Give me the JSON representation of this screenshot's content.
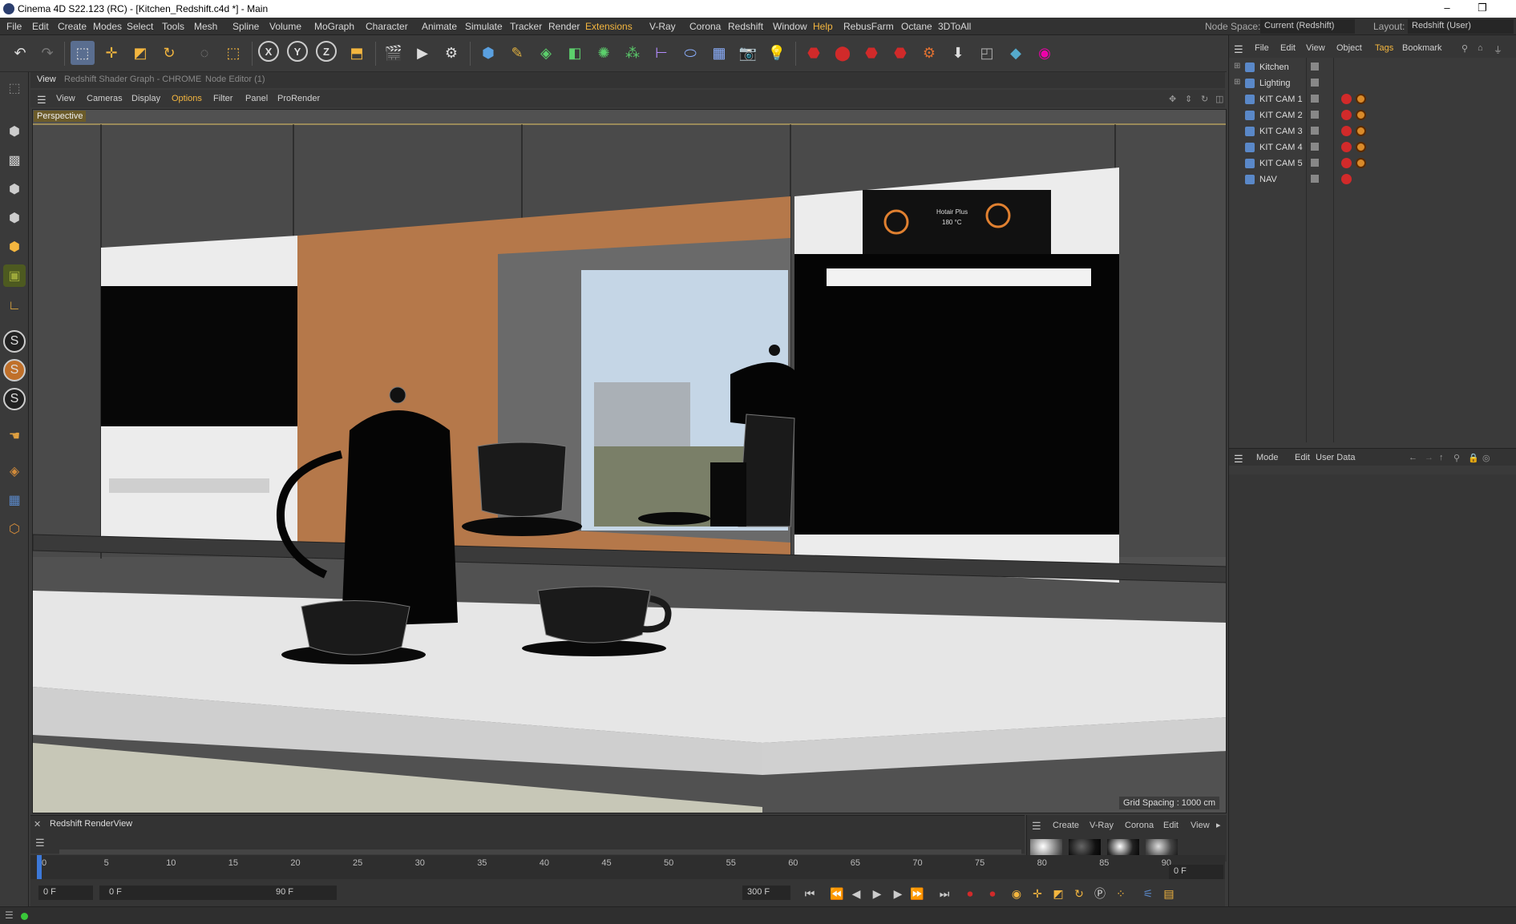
{
  "window": {
    "title": "Cinema 4D S22.123 (RC) - [Kitchen_Redshift.c4d *] - Main",
    "minimize": "–",
    "restore": "❐"
  },
  "menubar": {
    "items": [
      "File",
      "Edit",
      "Create",
      "Modes",
      "Select",
      "Tools",
      "Mesh",
      "Spline",
      "Volume",
      "MoGraph",
      "Character",
      "Animate",
      "Simulate",
      "Tracker",
      "Render",
      "Extensions",
      "V-Ray",
      "Corona",
      "Redshift",
      "Window",
      "Help",
      "RebusFarm",
      "Octane",
      "3DToAll"
    ],
    "node_space_label": "Node Space:",
    "node_space_value": "Current (Redshift)",
    "layout_label": "Layout:",
    "layout_value": "Redshift (User)"
  },
  "tabs": [
    "View",
    "Redshift Shader Graph - CHROME",
    "Node Editor (1)"
  ],
  "viewport_menu": [
    "View",
    "Cameras",
    "Display",
    "Options",
    "Filter",
    "Panel",
    "ProRender"
  ],
  "viewport": {
    "label": "Perspective",
    "grid_spacing": "Grid Spacing : 1000 cm",
    "oven_display": "Hotair Plus",
    "oven_temp": "180 °C"
  },
  "object_manager": {
    "menu": [
      "File",
      "Edit",
      "View",
      "Object",
      "Tags",
      "Bookmark"
    ],
    "objects": [
      {
        "name": "Kitchen",
        "tags": 0
      },
      {
        "name": "Lighting",
        "tags": 0
      },
      {
        "name": "KIT CAM 1",
        "tags": 2
      },
      {
        "name": "KIT CAM 2",
        "tags": 2
      },
      {
        "name": "KIT  CAM 3",
        "tags": 2
      },
      {
        "name": "KIT  CAM 4",
        "tags": 2
      },
      {
        "name": "KIT  CAM 5",
        "tags": 2
      },
      {
        "name": "NAV",
        "tags": 1
      }
    ]
  },
  "attributes": {
    "menu": [
      "Mode",
      "Edit",
      "User Data"
    ]
  },
  "renderview": {
    "title": "Redshift RenderView"
  },
  "material_panel": {
    "menu": [
      "Create",
      "V-Ray",
      "Corona",
      "Edit",
      "View"
    ]
  },
  "timeline": {
    "ticks": [
      "0",
      "5",
      "10",
      "15",
      "20",
      "25",
      "30",
      "35",
      "40",
      "45",
      "50",
      "55",
      "60",
      "65",
      "70",
      "75",
      "80",
      "85",
      "90"
    ]
  },
  "transport": {
    "start_frame": "0 F",
    "range_start": "0 F",
    "range_end": "90 F",
    "end_frame": "300 F",
    "current_frame": "0 F"
  },
  "colors": {
    "accent": "#f4b63f",
    "tag_red": "#d12a2a",
    "tag_orange": "#d98a2a"
  }
}
